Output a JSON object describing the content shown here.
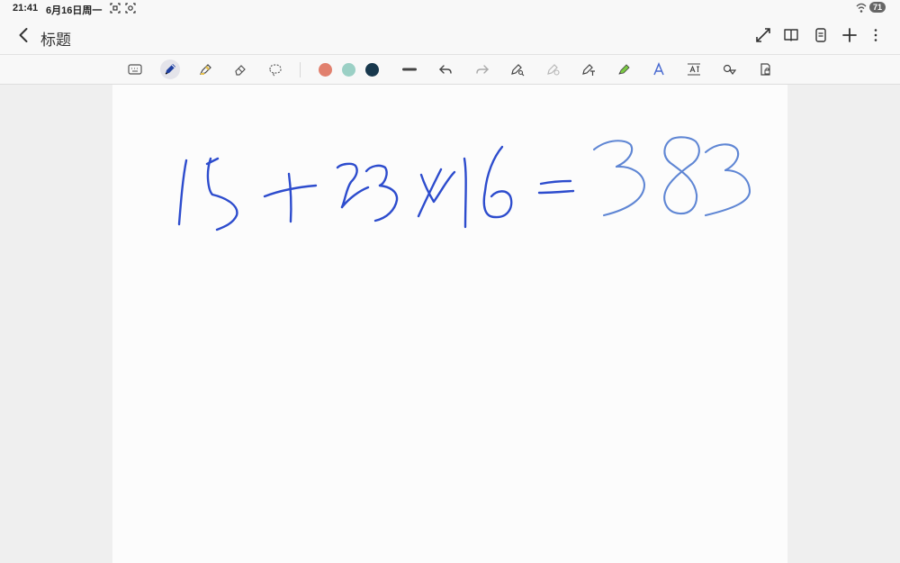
{
  "status_bar": {
    "time": "21:41",
    "date": "6月16日周一",
    "battery": "71"
  },
  "header": {
    "title": "标题"
  },
  "toolbar": {
    "pen_colors": [
      "#e1806e",
      "#9bd0c5",
      "#18384d"
    ],
    "active_tool": "pen"
  },
  "colors": {
    "ink_primary": "#2d4ccd",
    "ink_light": "#5f86d4",
    "background": "#efefef",
    "paper": "#fcfcfc"
  },
  "note": {
    "handwritten_text": "15+23×16=383"
  }
}
